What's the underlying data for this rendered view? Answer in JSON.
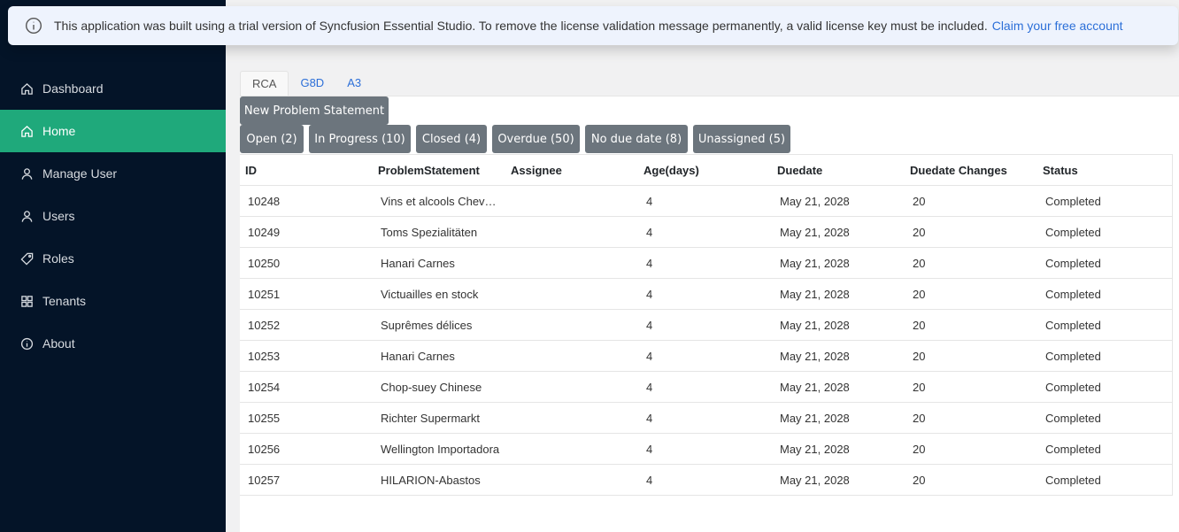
{
  "banner": {
    "message": "This application was built using a trial version of Syncfusion Essential Studio. To remove the license validation message permanently, a valid license key must be included.",
    "link": "Claim your free account",
    "icon": "info-icon"
  },
  "sidebar": {
    "items": [
      {
        "label": "Dashboard",
        "icon": "home-icon",
        "active": false
      },
      {
        "label": "Home",
        "icon": "home-icon",
        "active": true
      },
      {
        "label": "Manage User",
        "icon": "user-icon",
        "active": false
      },
      {
        "label": "Users",
        "icon": "user-icon",
        "active": false
      },
      {
        "label": "Roles",
        "icon": "tag-icon",
        "active": false
      },
      {
        "label": "Tenants",
        "icon": "grid-icon",
        "active": false
      },
      {
        "label": "About",
        "icon": "info-icon",
        "active": false
      }
    ]
  },
  "tabs": [
    {
      "label": "RCA",
      "active": true
    },
    {
      "label": "G8D",
      "active": false
    },
    {
      "label": "A3",
      "active": false
    }
  ],
  "actions": {
    "new_problem_statement": "New Problem Statement",
    "filters": [
      "Open (2)",
      "In Progress (10)",
      "Closed (4)",
      "Overdue (50)",
      "No due date (8)",
      "Unassigned (5)"
    ]
  },
  "grid": {
    "columns": [
      "ID",
      "ProblemStatement",
      "Assignee",
      "Age(days)",
      "Duedate",
      "Duedate Changes",
      "Status"
    ],
    "rows": [
      [
        "10248",
        "Vins et alcools Chevalier",
        "",
        "4",
        "May 21, 2028",
        "20",
        "Completed"
      ],
      [
        "10249",
        "Toms Spezialitäten",
        "",
        "4",
        "May 21, 2028",
        "20",
        "Completed"
      ],
      [
        "10250",
        "Hanari Carnes",
        "",
        "4",
        "May 21, 2028",
        "20",
        "Completed"
      ],
      [
        "10251",
        "Victuailles en stock",
        "",
        "4",
        "May 21, 2028",
        "20",
        "Completed"
      ],
      [
        "10252",
        "Suprêmes délices",
        "",
        "4",
        "May 21, 2028",
        "20",
        "Completed"
      ],
      [
        "10253",
        "Hanari Carnes",
        "",
        "4",
        "May 21, 2028",
        "20",
        "Completed"
      ],
      [
        "10254",
        "Chop-suey Chinese",
        "",
        "4",
        "May 21, 2028",
        "20",
        "Completed"
      ],
      [
        "10255",
        "Richter Supermarkt",
        "",
        "4",
        "May 21, 2028",
        "20",
        "Completed"
      ],
      [
        "10256",
        "Wellington Importadora",
        "",
        "4",
        "May 21, 2028",
        "20",
        "Completed"
      ],
      [
        "10257",
        "HILARION-Abastos",
        "",
        "4",
        "May 21, 2028",
        "20",
        "Completed"
      ]
    ]
  },
  "colors": {
    "sidebar_bg": "#041428",
    "active_green": "#1fa97b",
    "button_gray": "#6c757d",
    "link_blue": "#2c6fd8"
  }
}
